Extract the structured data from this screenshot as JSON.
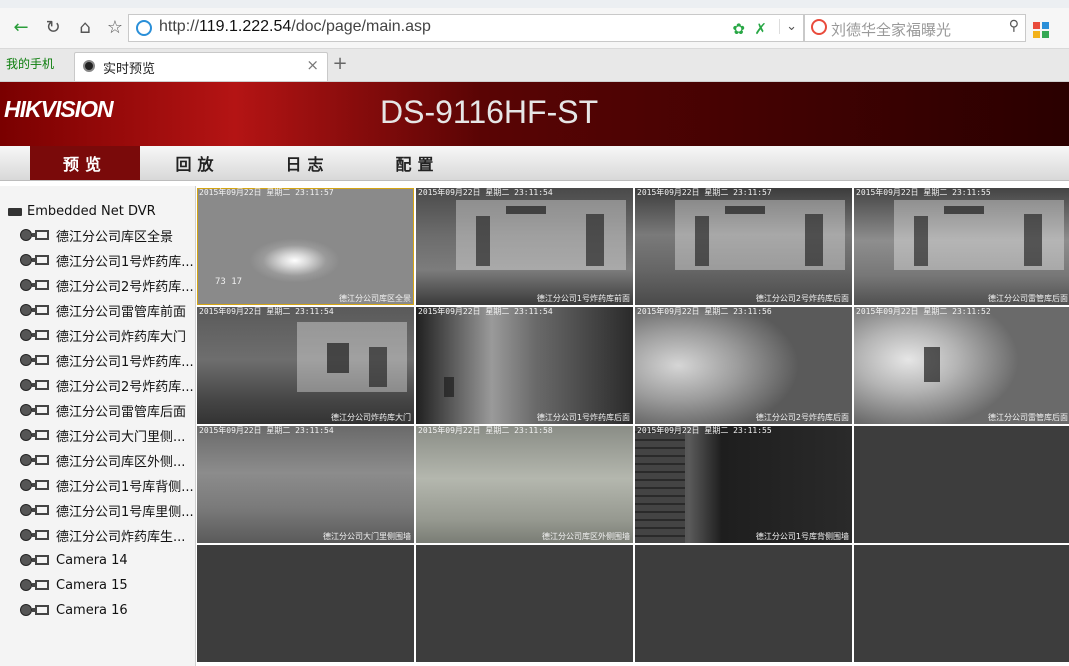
{
  "browser": {
    "address": {
      "scheme": "http://",
      "host": "119.1.222.54",
      "path": "/doc/page/main.asp"
    },
    "search_placeholder": "刘德华全家福曝光",
    "bookmark": "我的手机",
    "tab": {
      "title": "实时预览",
      "close": "×"
    },
    "newtab": "+"
  },
  "app": {
    "logo": "HIKVISION",
    "model": "DS-9116HF-ST",
    "menu": [
      {
        "label": "预览"
      },
      {
        "label": "回放"
      },
      {
        "label": "日志"
      },
      {
        "label": "配置"
      }
    ],
    "active_menu": "预览",
    "accent": "#7a0a0a"
  },
  "tree": {
    "root": "Embedded Net DVR",
    "cameras": [
      "德江分公司库区全景",
      "德江分公司1号炸药库...",
      "德江分公司2号炸药库...",
      "德江分公司雷管库前面",
      "德江分公司炸药库大门",
      "德江分公司1号炸药库...",
      "德江分公司2号炸药库...",
      "德江分公司雷管库后面",
      "德江分公司大门里侧...",
      "德江分公司库区外侧...",
      "德江分公司1号库背侧...",
      "德江分公司1号库里侧...",
      "德江分公司炸药库生...",
      "Camera 14",
      "Camera 15",
      "Camera 16"
    ]
  },
  "feeds": [
    {
      "time": "2015年09月22日 星期二 23:11:57",
      "name": "德江分公司库区全景",
      "extra": "73 17"
    },
    {
      "time": "2015年09月22日 星期二 23:11:54",
      "name": "德江分公司1号炸药库前面"
    },
    {
      "time": "2015年09月22日 星期二 23:11:57",
      "name": "德江分公司2号炸药库后面"
    },
    {
      "time": "2015年09月22日 星期二 23:11:55",
      "name": "德江分公司雷管库后面"
    },
    {
      "time": "2015年09月22日 星期二 23:11:54",
      "name": "德江分公司炸药库大门"
    },
    {
      "time": "2015年09月22日 星期二 23:11:54",
      "name": "德江分公司1号炸药库后面"
    },
    {
      "time": "2015年09月22日 星期二 23:11:56",
      "name": "德江分公司2号炸药库后面"
    },
    {
      "time": "2015年09月22日 星期二 23:11:52",
      "name": "德江分公司雷管库后面"
    },
    {
      "time": "2015年09月22日 星期二 23:11:54",
      "name": "德江分公司大门里侧围墙"
    },
    {
      "time": "2015年09月22日 星期二 23:11:58",
      "name": "德江分公司库区外侧围墙"
    },
    {
      "time": "2015年09月22日 星期二 23:11:55",
      "name": "德江分公司1号库背侧围墙"
    }
  ]
}
